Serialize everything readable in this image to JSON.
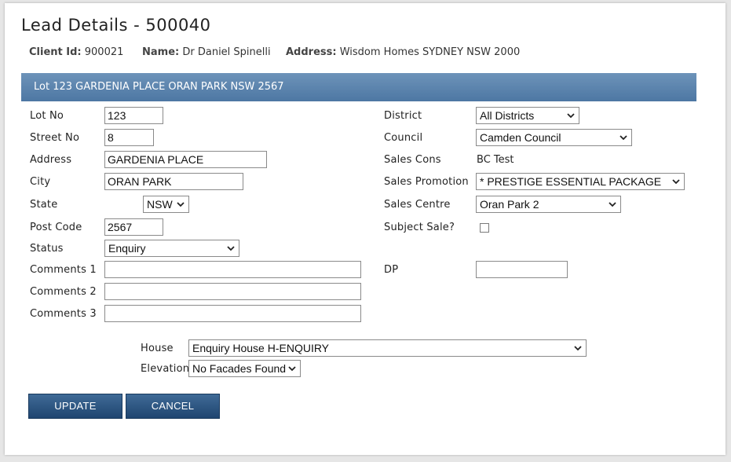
{
  "page": {
    "title": "Lead Details - 500040"
  },
  "summary": {
    "client_id_label": "Client Id:",
    "client_id_value": "900021",
    "name_label": "Name:",
    "name_value": "Dr Daniel Spinelli",
    "address_label": "Address:",
    "address_value": "Wisdom Homes SYDNEY NSW 2000"
  },
  "section": {
    "header": "Lot 123 GARDENIA PLACE ORAN PARK NSW 2567"
  },
  "left": {
    "lot_no": {
      "label": "Lot No",
      "value": "123"
    },
    "street_no": {
      "label": "Street No",
      "value": "8"
    },
    "address": {
      "label": "Address",
      "value": "GARDENIA PLACE"
    },
    "city": {
      "label": "City",
      "value": "ORAN PARK"
    },
    "state": {
      "label": "State",
      "value": "NSW"
    },
    "post_code": {
      "label": "Post Code",
      "value": "2567"
    },
    "status": {
      "label": "Status",
      "value": "Enquiry"
    },
    "comments1": {
      "label": "Comments 1",
      "value": ""
    },
    "comments2": {
      "label": "Comments 2",
      "value": ""
    },
    "comments3": {
      "label": "Comments 3",
      "value": ""
    }
  },
  "right": {
    "district": {
      "label": "District",
      "value": "All Districts"
    },
    "council": {
      "label": "Council",
      "value": "Camden Council"
    },
    "sales_cons": {
      "label": "Sales Cons",
      "value": "BC Test"
    },
    "sales_promotion": {
      "label": "Sales Promotion",
      "value": "* PRESTIGE ESSENTIAL PACKAGE"
    },
    "sales_centre": {
      "label": "Sales Centre",
      "value": "Oran Park 2"
    },
    "subject_sale": {
      "label": "Subject Sale?",
      "checked": false
    },
    "dp": {
      "label": "DP",
      "value": ""
    }
  },
  "house": {
    "house_label": "House",
    "house_value": "Enquiry House H-ENQUIRY",
    "elevation_label": "Elevation",
    "elevation_value": "No Facades Found"
  },
  "buttons": {
    "update": "UPDATE",
    "cancel": "CANCEL"
  },
  "colors": {
    "header_bar": "#5a82ac",
    "button": "#2d5682"
  },
  "icons": {
    "dropdown": "chevron-down-icon"
  }
}
